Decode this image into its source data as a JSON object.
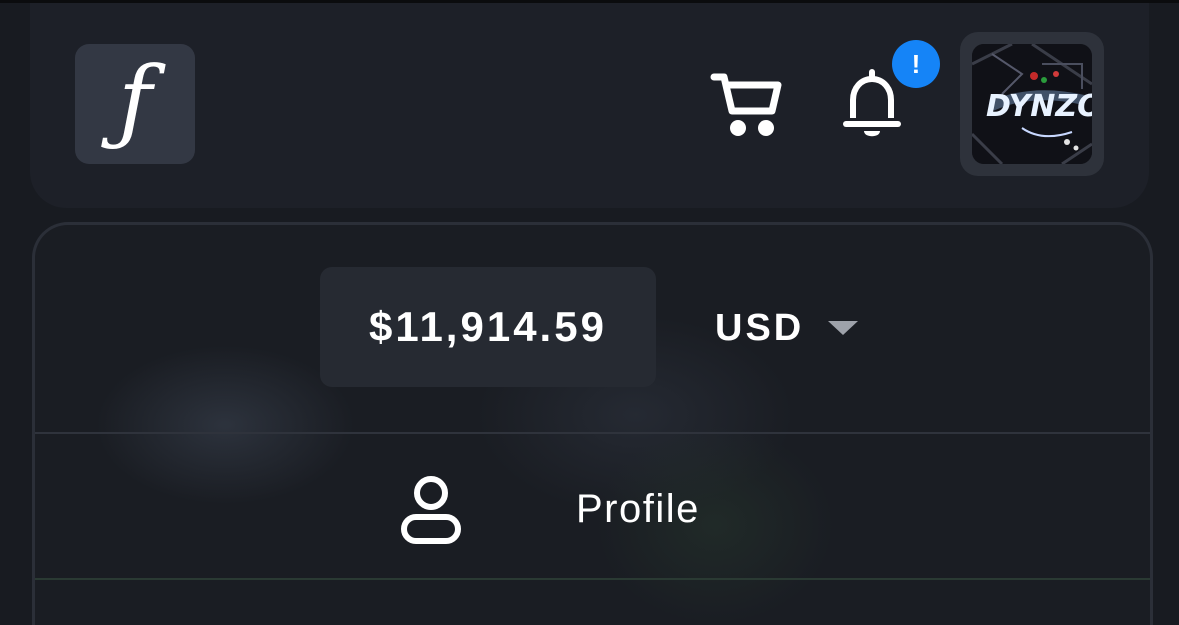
{
  "header": {
    "logo_letter": "ƒ",
    "cart_icon": "cart-icon",
    "bell_icon": "bell-icon",
    "notification_badge": "!",
    "avatar_text": "DYNZO"
  },
  "wallet": {
    "balance": "$11,914.59",
    "currency": "USD"
  },
  "menu": {
    "profile_label": "Profile",
    "profile_icon": "user-icon"
  },
  "colors": {
    "background": "#181b21",
    "header_bg": "#1d2028",
    "badge": "#1584f7",
    "logo_bg": "#333844"
  }
}
